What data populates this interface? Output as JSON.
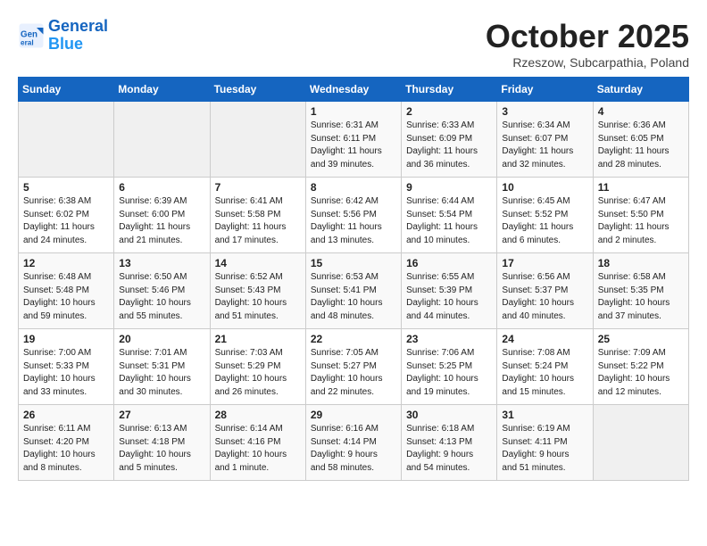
{
  "header": {
    "logo_line1": "General",
    "logo_line2": "Blue",
    "month": "October 2025",
    "location": "Rzeszow, Subcarpathia, Poland"
  },
  "days_of_week": [
    "Sunday",
    "Monday",
    "Tuesday",
    "Wednesday",
    "Thursday",
    "Friday",
    "Saturday"
  ],
  "weeks": [
    [
      {
        "day": "",
        "info": ""
      },
      {
        "day": "",
        "info": ""
      },
      {
        "day": "",
        "info": ""
      },
      {
        "day": "1",
        "info": "Sunrise: 6:31 AM\nSunset: 6:11 PM\nDaylight: 11 hours\nand 39 minutes."
      },
      {
        "day": "2",
        "info": "Sunrise: 6:33 AM\nSunset: 6:09 PM\nDaylight: 11 hours\nand 36 minutes."
      },
      {
        "day": "3",
        "info": "Sunrise: 6:34 AM\nSunset: 6:07 PM\nDaylight: 11 hours\nand 32 minutes."
      },
      {
        "day": "4",
        "info": "Sunrise: 6:36 AM\nSunset: 6:05 PM\nDaylight: 11 hours\nand 28 minutes."
      }
    ],
    [
      {
        "day": "5",
        "info": "Sunrise: 6:38 AM\nSunset: 6:02 PM\nDaylight: 11 hours\nand 24 minutes."
      },
      {
        "day": "6",
        "info": "Sunrise: 6:39 AM\nSunset: 6:00 PM\nDaylight: 11 hours\nand 21 minutes."
      },
      {
        "day": "7",
        "info": "Sunrise: 6:41 AM\nSunset: 5:58 PM\nDaylight: 11 hours\nand 17 minutes."
      },
      {
        "day": "8",
        "info": "Sunrise: 6:42 AM\nSunset: 5:56 PM\nDaylight: 11 hours\nand 13 minutes."
      },
      {
        "day": "9",
        "info": "Sunrise: 6:44 AM\nSunset: 5:54 PM\nDaylight: 11 hours\nand 10 minutes."
      },
      {
        "day": "10",
        "info": "Sunrise: 6:45 AM\nSunset: 5:52 PM\nDaylight: 11 hours\nand 6 minutes."
      },
      {
        "day": "11",
        "info": "Sunrise: 6:47 AM\nSunset: 5:50 PM\nDaylight: 11 hours\nand 2 minutes."
      }
    ],
    [
      {
        "day": "12",
        "info": "Sunrise: 6:48 AM\nSunset: 5:48 PM\nDaylight: 10 hours\nand 59 minutes."
      },
      {
        "day": "13",
        "info": "Sunrise: 6:50 AM\nSunset: 5:46 PM\nDaylight: 10 hours\nand 55 minutes."
      },
      {
        "day": "14",
        "info": "Sunrise: 6:52 AM\nSunset: 5:43 PM\nDaylight: 10 hours\nand 51 minutes."
      },
      {
        "day": "15",
        "info": "Sunrise: 6:53 AM\nSunset: 5:41 PM\nDaylight: 10 hours\nand 48 minutes."
      },
      {
        "day": "16",
        "info": "Sunrise: 6:55 AM\nSunset: 5:39 PM\nDaylight: 10 hours\nand 44 minutes."
      },
      {
        "day": "17",
        "info": "Sunrise: 6:56 AM\nSunset: 5:37 PM\nDaylight: 10 hours\nand 40 minutes."
      },
      {
        "day": "18",
        "info": "Sunrise: 6:58 AM\nSunset: 5:35 PM\nDaylight: 10 hours\nand 37 minutes."
      }
    ],
    [
      {
        "day": "19",
        "info": "Sunrise: 7:00 AM\nSunset: 5:33 PM\nDaylight: 10 hours\nand 33 minutes."
      },
      {
        "day": "20",
        "info": "Sunrise: 7:01 AM\nSunset: 5:31 PM\nDaylight: 10 hours\nand 30 minutes."
      },
      {
        "day": "21",
        "info": "Sunrise: 7:03 AM\nSunset: 5:29 PM\nDaylight: 10 hours\nand 26 minutes."
      },
      {
        "day": "22",
        "info": "Sunrise: 7:05 AM\nSunset: 5:27 PM\nDaylight: 10 hours\nand 22 minutes."
      },
      {
        "day": "23",
        "info": "Sunrise: 7:06 AM\nSunset: 5:25 PM\nDaylight: 10 hours\nand 19 minutes."
      },
      {
        "day": "24",
        "info": "Sunrise: 7:08 AM\nSunset: 5:24 PM\nDaylight: 10 hours\nand 15 minutes."
      },
      {
        "day": "25",
        "info": "Sunrise: 7:09 AM\nSunset: 5:22 PM\nDaylight: 10 hours\nand 12 minutes."
      }
    ],
    [
      {
        "day": "26",
        "info": "Sunrise: 6:11 AM\nSunset: 4:20 PM\nDaylight: 10 hours\nand 8 minutes."
      },
      {
        "day": "27",
        "info": "Sunrise: 6:13 AM\nSunset: 4:18 PM\nDaylight: 10 hours\nand 5 minutes."
      },
      {
        "day": "28",
        "info": "Sunrise: 6:14 AM\nSunset: 4:16 PM\nDaylight: 10 hours\nand 1 minute."
      },
      {
        "day": "29",
        "info": "Sunrise: 6:16 AM\nSunset: 4:14 PM\nDaylight: 9 hours\nand 58 minutes."
      },
      {
        "day": "30",
        "info": "Sunrise: 6:18 AM\nSunset: 4:13 PM\nDaylight: 9 hours\nand 54 minutes."
      },
      {
        "day": "31",
        "info": "Sunrise: 6:19 AM\nSunset: 4:11 PM\nDaylight: 9 hours\nand 51 minutes."
      },
      {
        "day": "",
        "info": ""
      }
    ]
  ]
}
